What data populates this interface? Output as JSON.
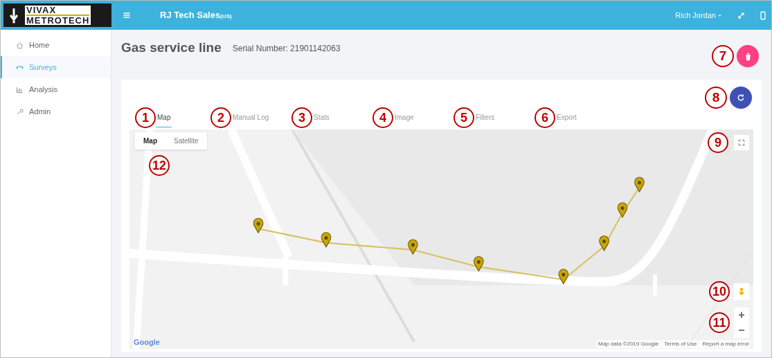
{
  "header": {
    "brand_top": "VIVAX",
    "brand_bottom": "METROTECH",
    "org": "RJ Tech Sales",
    "org_suffix": "(US)",
    "user": "Rich Jordan"
  },
  "sidebar": {
    "items": [
      {
        "label": "Home",
        "selected": false
      },
      {
        "label": "Surveys",
        "selected": true
      },
      {
        "label": "Analysis",
        "selected": false
      },
      {
        "label": "Admin",
        "selected": false
      }
    ]
  },
  "page": {
    "title": "Gas service line",
    "serial": "Serial Number: 21901142063",
    "delete_callout": "7",
    "refresh_callout": "8"
  },
  "tabs": [
    {
      "label": "Map",
      "callout": "1",
      "selected": true
    },
    {
      "label": "Manual Log",
      "callout": "2",
      "selected": false
    },
    {
      "label": "Stats",
      "callout": "3",
      "selected": false
    },
    {
      "label": "Image",
      "callout": "4",
      "selected": false
    },
    {
      "label": "Filters",
      "callout": "5",
      "selected": false
    },
    {
      "label": "Export",
      "callout": "6",
      "selected": false
    }
  ],
  "map": {
    "types": [
      {
        "label": "Map",
        "selected": true
      },
      {
        "label": "Satellite",
        "selected": false
      }
    ],
    "type_callout": "12",
    "fullscreen_callout": "9",
    "pegman_callout": "10",
    "zoom_callout": "11",
    "zoom_in": "+",
    "zoom_out": "−",
    "logo": "Google",
    "footer": [
      "Map data ©2019 Google",
      "Terms of Use",
      "Report a map error"
    ]
  }
}
